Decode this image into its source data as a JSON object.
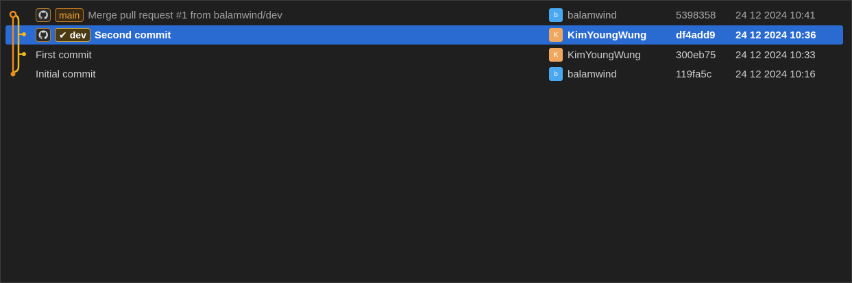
{
  "colors": {
    "background": "#1f1f1f",
    "selected_row": "#2a6bd1",
    "graph_line": "#f2b81c",
    "graph_merge": "#f08a1a",
    "ref_badge_border": "#c47a22"
  },
  "commits": [
    {
      "refs": [
        {
          "icon": "github-icon"
        },
        {
          "label": "main"
        }
      ],
      "message": "Merge pull request #1 from balamwind/dev",
      "avatar_letter": "b",
      "author": "balamwind",
      "hash": "5398358",
      "date": "24 12 2024 10:41"
    },
    {
      "refs": [
        {
          "icon": "github-icon"
        },
        {
          "label": "dev",
          "checked_icon": "check-icon"
        }
      ],
      "message": "Second commit",
      "avatar_letter": "K",
      "author": "KimYoungWung",
      "hash": "df4add9",
      "date": "24 12 2024 10:36"
    },
    {
      "message": "First commit",
      "avatar_letter": "K",
      "author": "KimYoungWung",
      "hash": "300eb75",
      "date": "24 12 2024 10:33"
    },
    {
      "message": "Initial commit",
      "avatar_letter": "b",
      "author": "balamwind",
      "hash": "119fa5c",
      "date": "24 12 2024 10:16"
    }
  ]
}
